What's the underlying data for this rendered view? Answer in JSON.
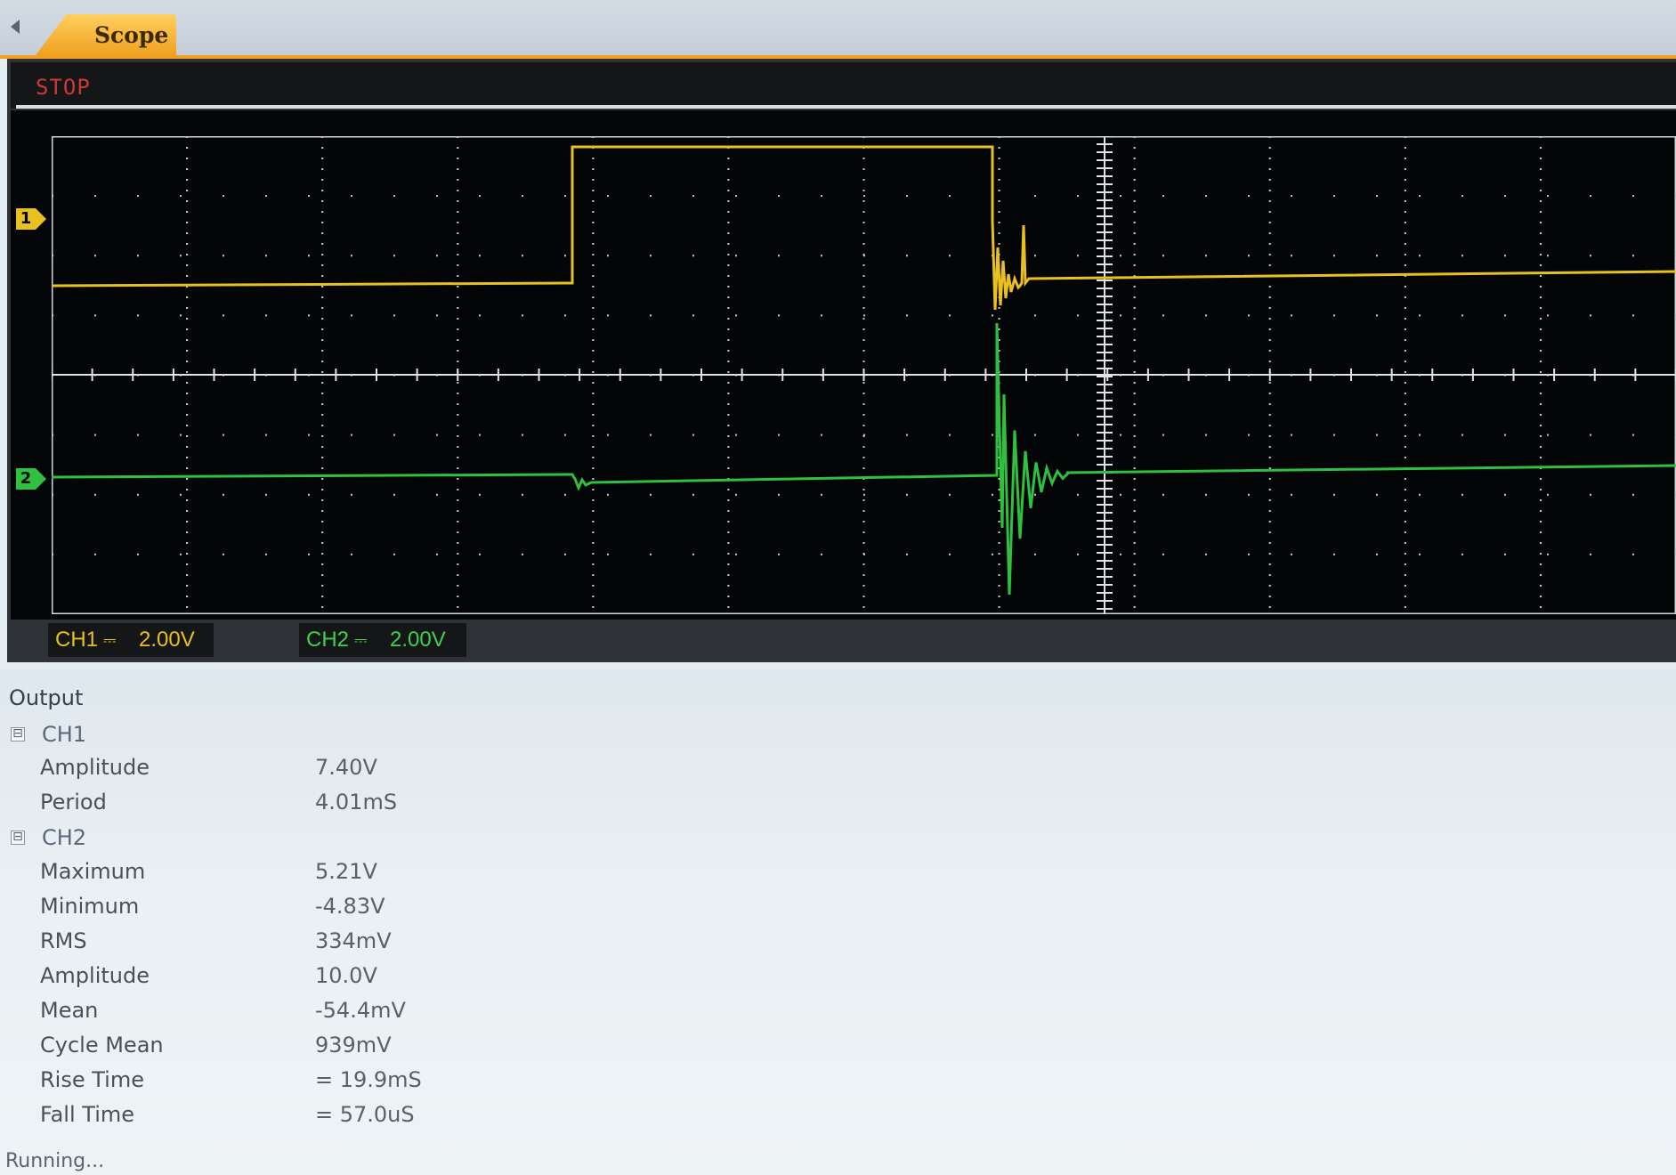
{
  "tab": {
    "label": "Scope"
  },
  "scope": {
    "run_state": "STOP",
    "channel1": {
      "marker": "1",
      "name": "CH1",
      "coupling": "⎓",
      "scale": "2.00V",
      "color": "#e8c020"
    },
    "channel2": {
      "marker": "2",
      "name": "CH2",
      "coupling": "⎓",
      "scale": "2.00V",
      "color": "#30c040"
    }
  },
  "output": {
    "title": "Output",
    "groups": [
      {
        "name": "CH1",
        "toggle": "⊟",
        "items": [
          {
            "label": "Amplitude",
            "value": "7.40V"
          },
          {
            "label": "Period",
            "value": "4.01mS"
          }
        ]
      },
      {
        "name": "CH2",
        "toggle": "⊟",
        "items": [
          {
            "label": "Maximum",
            "value": "5.21V"
          },
          {
            "label": "Minimum",
            "value": "-4.83V"
          },
          {
            "label": "RMS",
            "value": "334mV"
          },
          {
            "label": "Amplitude",
            "value": "10.0V"
          },
          {
            "label": "Mean",
            "value": "-54.4mV"
          },
          {
            "label": "Cycle Mean",
            "value": "939mV"
          },
          {
            "label": "Rise Time",
            "value": "= 19.9mS"
          },
          {
            "label": "Fall Time",
            "value": "= 57.0uS"
          }
        ]
      }
    ]
  },
  "status": {
    "text": "Running..."
  }
}
